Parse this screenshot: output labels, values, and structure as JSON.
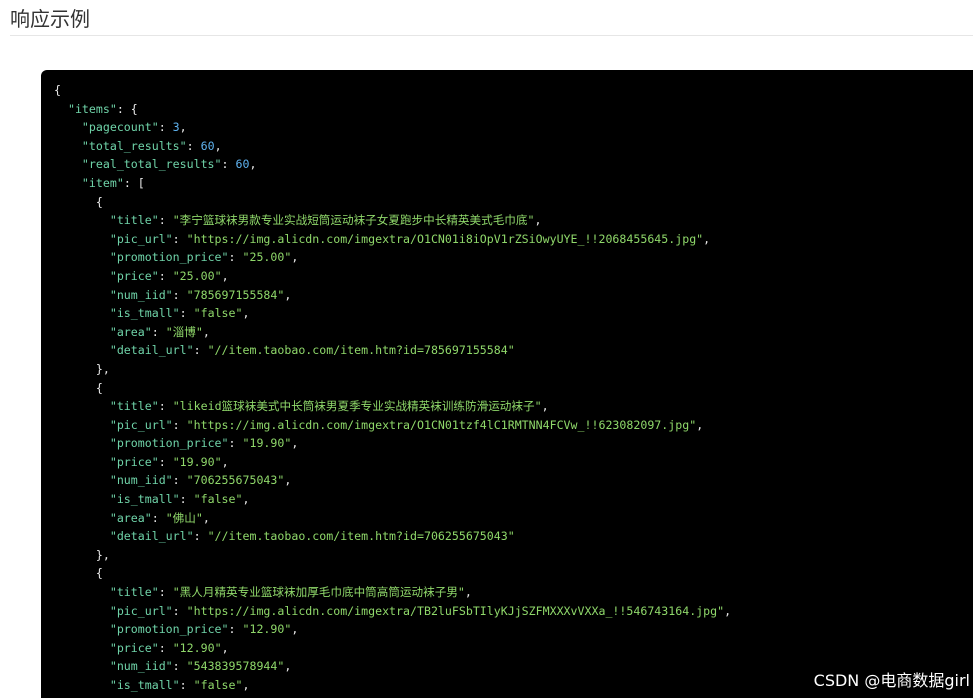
{
  "section": {
    "title": "响应示例"
  },
  "code_lines": [
    [
      [
        "p",
        "{"
      ]
    ],
    [
      [
        "p",
        "  "
      ],
      [
        "k",
        "\"items\""
      ],
      [
        "p",
        ": {"
      ]
    ],
    [
      [
        "p",
        "    "
      ],
      [
        "k",
        "\"pagecount\""
      ],
      [
        "p",
        ": "
      ],
      [
        "n",
        "3"
      ],
      [
        "p",
        ","
      ]
    ],
    [
      [
        "p",
        "    "
      ],
      [
        "k",
        "\"total_results\""
      ],
      [
        "p",
        ": "
      ],
      [
        "n",
        "60"
      ],
      [
        "p",
        ","
      ]
    ],
    [
      [
        "p",
        "    "
      ],
      [
        "k",
        "\"real_total_results\""
      ],
      [
        "p",
        ": "
      ],
      [
        "n",
        "60"
      ],
      [
        "p",
        ","
      ]
    ],
    [
      [
        "p",
        "    "
      ],
      [
        "k",
        "\"item\""
      ],
      [
        "p",
        ": ["
      ]
    ],
    [
      [
        "p",
        "      {"
      ]
    ],
    [
      [
        "p",
        "        "
      ],
      [
        "k",
        "\"title\""
      ],
      [
        "p",
        ": "
      ],
      [
        "s",
        "\"李宁篮球袜男款专业实战短筒运动袜子女夏跑步中长精英美式毛巾底\""
      ],
      [
        "p",
        ","
      ]
    ],
    [
      [
        "p",
        "        "
      ],
      [
        "k",
        "\"pic_url\""
      ],
      [
        "p",
        ": "
      ],
      [
        "s",
        "\"https://img.alicdn.com/imgextra/O1CN01i8iOpV1rZSiOwyUYE_!!2068455645.jpg\""
      ],
      [
        "p",
        ","
      ]
    ],
    [
      [
        "p",
        "        "
      ],
      [
        "k",
        "\"promotion_price\""
      ],
      [
        "p",
        ": "
      ],
      [
        "s",
        "\"25.00\""
      ],
      [
        "p",
        ","
      ]
    ],
    [
      [
        "p",
        "        "
      ],
      [
        "k",
        "\"price\""
      ],
      [
        "p",
        ": "
      ],
      [
        "s",
        "\"25.00\""
      ],
      [
        "p",
        ","
      ]
    ],
    [
      [
        "p",
        "        "
      ],
      [
        "k",
        "\"num_iid\""
      ],
      [
        "p",
        ": "
      ],
      [
        "s",
        "\"785697155584\""
      ],
      [
        "p",
        ","
      ]
    ],
    [
      [
        "p",
        "        "
      ],
      [
        "k",
        "\"is_tmall\""
      ],
      [
        "p",
        ": "
      ],
      [
        "s",
        "\"false\""
      ],
      [
        "p",
        ","
      ]
    ],
    [
      [
        "p",
        "        "
      ],
      [
        "k",
        "\"area\""
      ],
      [
        "p",
        ": "
      ],
      [
        "s",
        "\"淄博\""
      ],
      [
        "p",
        ","
      ]
    ],
    [
      [
        "p",
        "        "
      ],
      [
        "k",
        "\"detail_url\""
      ],
      [
        "p",
        ": "
      ],
      [
        "s",
        "\"//item.taobao.com/item.htm?id=785697155584\""
      ]
    ],
    [
      [
        "p",
        "      },"
      ]
    ],
    [
      [
        "p",
        "      {"
      ]
    ],
    [
      [
        "p",
        "        "
      ],
      [
        "k",
        "\"title\""
      ],
      [
        "p",
        ": "
      ],
      [
        "s",
        "\"likeid篮球袜美式中长筒袜男夏季专业实战精英袜训练防滑运动袜子\""
      ],
      [
        "p",
        ","
      ]
    ],
    [
      [
        "p",
        "        "
      ],
      [
        "k",
        "\"pic_url\""
      ],
      [
        "p",
        ": "
      ],
      [
        "s",
        "\"https://img.alicdn.com/imgextra/O1CN01tzf4lC1RMTNN4FCVw_!!623082097.jpg\""
      ],
      [
        "p",
        ","
      ]
    ],
    [
      [
        "p",
        "        "
      ],
      [
        "k",
        "\"promotion_price\""
      ],
      [
        "p",
        ": "
      ],
      [
        "s",
        "\"19.90\""
      ],
      [
        "p",
        ","
      ]
    ],
    [
      [
        "p",
        "        "
      ],
      [
        "k",
        "\"price\""
      ],
      [
        "p",
        ": "
      ],
      [
        "s",
        "\"19.90\""
      ],
      [
        "p",
        ","
      ]
    ],
    [
      [
        "p",
        "        "
      ],
      [
        "k",
        "\"num_iid\""
      ],
      [
        "p",
        ": "
      ],
      [
        "s",
        "\"706255675043\""
      ],
      [
        "p",
        ","
      ]
    ],
    [
      [
        "p",
        "        "
      ],
      [
        "k",
        "\"is_tmall\""
      ],
      [
        "p",
        ": "
      ],
      [
        "s",
        "\"false\""
      ],
      [
        "p",
        ","
      ]
    ],
    [
      [
        "p",
        "        "
      ],
      [
        "k",
        "\"area\""
      ],
      [
        "p",
        ": "
      ],
      [
        "s",
        "\"佛山\""
      ],
      [
        "p",
        ","
      ]
    ],
    [
      [
        "p",
        "        "
      ],
      [
        "k",
        "\"detail_url\""
      ],
      [
        "p",
        ": "
      ],
      [
        "s",
        "\"//item.taobao.com/item.htm?id=706255675043\""
      ]
    ],
    [
      [
        "p",
        "      },"
      ]
    ],
    [
      [
        "p",
        "      {"
      ]
    ],
    [
      [
        "p",
        "        "
      ],
      [
        "k",
        "\"title\""
      ],
      [
        "p",
        ": "
      ],
      [
        "s",
        "\"黑人月精英专业篮球袜加厚毛巾底中筒高筒运动袜子男\""
      ],
      [
        "p",
        ","
      ]
    ],
    [
      [
        "p",
        "        "
      ],
      [
        "k",
        "\"pic_url\""
      ],
      [
        "p",
        ": "
      ],
      [
        "s",
        "\"https://img.alicdn.com/imgextra/TB2luFSbTIlyKJjSZFMXXXvVXXa_!!546743164.jpg\""
      ],
      [
        "p",
        ","
      ]
    ],
    [
      [
        "p",
        "        "
      ],
      [
        "k",
        "\"promotion_price\""
      ],
      [
        "p",
        ": "
      ],
      [
        "s",
        "\"12.90\""
      ],
      [
        "p",
        ","
      ]
    ],
    [
      [
        "p",
        "        "
      ],
      [
        "k",
        "\"price\""
      ],
      [
        "p",
        ": "
      ],
      [
        "s",
        "\"12.90\""
      ],
      [
        "p",
        ","
      ]
    ],
    [
      [
        "p",
        "        "
      ],
      [
        "k",
        "\"num_iid\""
      ],
      [
        "p",
        ": "
      ],
      [
        "s",
        "\"543839578944\""
      ],
      [
        "p",
        ","
      ]
    ],
    [
      [
        "p",
        "        "
      ],
      [
        "k",
        "\"is_tmall\""
      ],
      [
        "p",
        ": "
      ],
      [
        "s",
        "\"false\""
      ],
      [
        "p",
        ","
      ]
    ]
  ],
  "watermark": {
    "text": "CSDN @电商数据girl"
  },
  "colors": {
    "code_background": "#000000",
    "json_key": "#6fd3a8",
    "json_string": "#8fd86a",
    "json_number": "#5fb3f0",
    "punctuation": "#e8e8e8"
  }
}
